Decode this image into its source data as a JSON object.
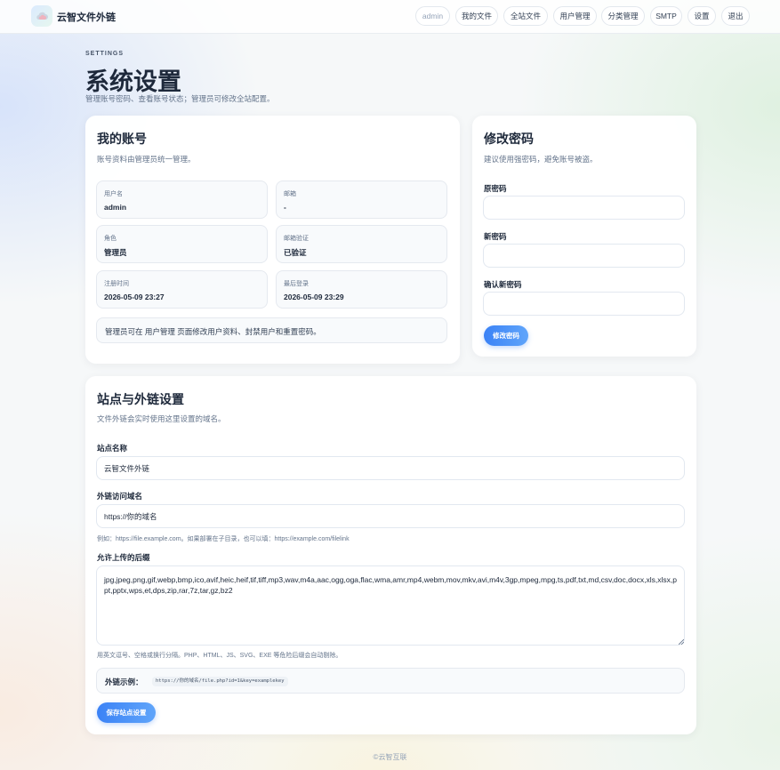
{
  "header": {
    "brand": "云智文件外链",
    "nav": [
      "admin",
      "我的文件",
      "全站文件",
      "用户管理",
      "分类管理",
      "SMTP",
      "设置",
      "退出"
    ]
  },
  "page": {
    "eyebrow": "SETTINGS",
    "title": "系统设置",
    "subtitle": "管理账号密码、查看账号状态；管理员可修改全站配置。"
  },
  "account": {
    "title": "我的账号",
    "subtitle": "账号资料由管理员统一管理。",
    "fields": [
      {
        "label": "用户名",
        "value": "admin"
      },
      {
        "label": "邮箱",
        "value": "-"
      },
      {
        "label": "角色",
        "value": "管理员"
      },
      {
        "label": "邮箱验证",
        "value": "已验证"
      },
      {
        "label": "注册时间",
        "value": "2026-05-09 23:27"
      },
      {
        "label": "最后登录",
        "value": "2026-05-09 23:29"
      }
    ],
    "note": "管理员可在 用户管理 页面修改用户资料、封禁用户和重置密码。"
  },
  "password": {
    "title": "修改密码",
    "subtitle": "建议使用强密码，避免账号被盗。",
    "old_label": "原密码",
    "new_label": "新密码",
    "confirm_label": "确认新密码",
    "submit": "修改密码"
  },
  "site": {
    "title": "站点与外链设置",
    "subtitle": "文件外链会实时使用这里设置的域名。",
    "name_label": "站点名称",
    "name_value": "云智文件外链",
    "domain_label": "外链访问域名",
    "domain_value": "https://你的域名",
    "domain_hint": "例如：https://file.example.com。如果部署在子目录，也可以填：https://example.com/filelink",
    "ext_label": "允许上传的后缀",
    "ext_value": "jpg,jpeg,png,gif,webp,bmp,ico,avif,heic,heif,tif,tiff,mp3,wav,m4a,aac,ogg,oga,flac,wma,amr,mp4,webm,mov,mkv,avi,m4v,3gp,mpeg,mpg,ts,pdf,txt,md,csv,doc,docx,xls,xlsx,ppt,pptx,wps,et,dps,zip,rar,7z,tar,gz,bz2",
    "ext_hint": "用英文逗号、空格或换行分隔。PHP、HTML、JS、SVG、EXE 等危险后缀会自动剔除。",
    "example_label": "外链示例：",
    "example_code": "https://你的域名/file.php?id=1&key=examplekey",
    "save": "保存站点设置"
  },
  "footer": "©云智互联"
}
